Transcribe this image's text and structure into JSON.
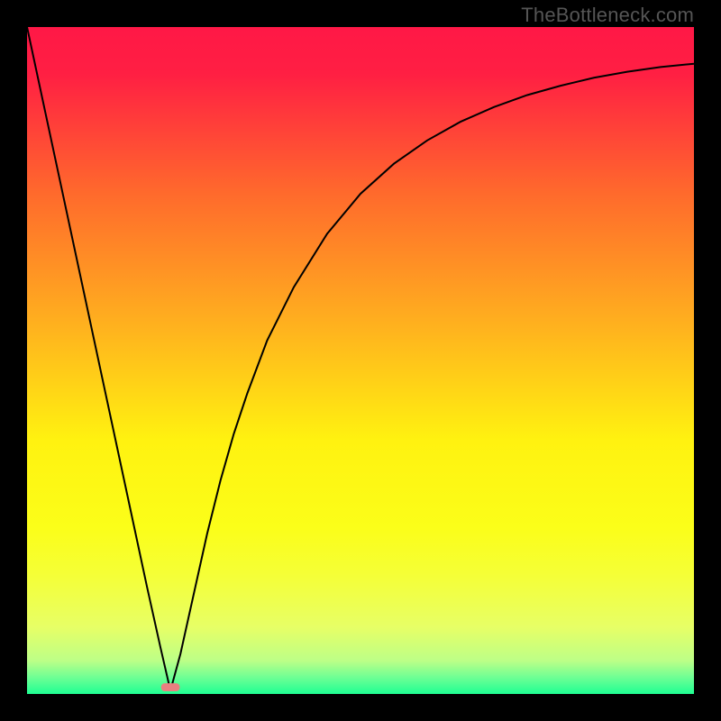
{
  "source_watermark": "TheBottleneck.com",
  "chart_data": {
    "type": "line",
    "title": "",
    "xlabel": "",
    "ylabel": "",
    "xlim": [
      0,
      100
    ],
    "ylim": [
      0,
      100
    ],
    "grid": false,
    "legend": false,
    "background_gradient": {
      "stops": [
        {
          "pos": 0.0,
          "color": "#ff1846"
        },
        {
          "pos": 0.07,
          "color": "#ff1f43"
        },
        {
          "pos": 0.25,
          "color": "#ff6a2c"
        },
        {
          "pos": 0.45,
          "color": "#ffb21e"
        },
        {
          "pos": 0.62,
          "color": "#fff210"
        },
        {
          "pos": 0.75,
          "color": "#fbfe19"
        },
        {
          "pos": 0.82,
          "color": "#f5ff36"
        },
        {
          "pos": 0.9,
          "color": "#e7ff66"
        },
        {
          "pos": 0.95,
          "color": "#bdff87"
        },
        {
          "pos": 0.975,
          "color": "#6fff94"
        },
        {
          "pos": 1.0,
          "color": "#1fff93"
        }
      ]
    },
    "marker": {
      "x": 21.5,
      "y": 1.0,
      "color": "#e98080",
      "shape": "rounded-rect",
      "width_frac": 0.028,
      "height_frac": 0.012
    },
    "series": [
      {
        "name": "curve",
        "color": "#000000",
        "stroke_width": 2,
        "x": [
          0,
          3,
          6,
          9,
          12,
          15,
          18,
          20,
          21.5,
          23,
          25,
          27,
          29,
          31,
          33,
          36,
          40,
          45,
          50,
          55,
          60,
          65,
          70,
          75,
          80,
          85,
          90,
          95,
          100
        ],
        "y": [
          100,
          86,
          72,
          58,
          44,
          30,
          16,
          7,
          0.5,
          6,
          15,
          24,
          32,
          39,
          45,
          53,
          61,
          69,
          75,
          79.5,
          83,
          85.8,
          88,
          89.8,
          91.2,
          92.4,
          93.3,
          94,
          94.5
        ]
      }
    ]
  }
}
